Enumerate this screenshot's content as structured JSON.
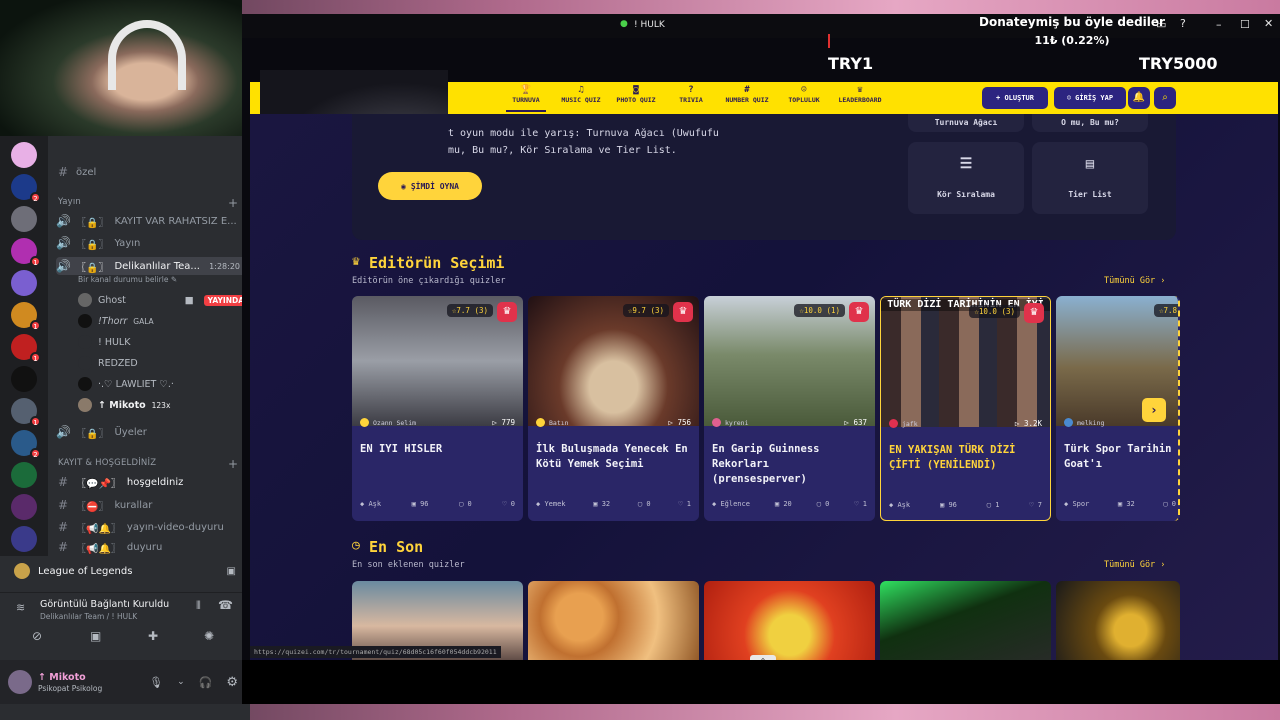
{
  "discord": {
    "channels": [
      {
        "label": "özel",
        "icon": "#"
      },
      {
        "label": "KAYIT VAR RAHATSIZ E...",
        "icon": "🔊"
      },
      {
        "label": "Yayın",
        "icon": "🔊"
      },
      {
        "label": "Delikanlılar Tea...",
        "icon": "🔊",
        "time": "1:28:20",
        "status": "Bir kanal durumu belirle ✎"
      }
    ],
    "category_yayin": "Yayın",
    "members": [
      {
        "name": "Ghost",
        "badge": "YAYINDA"
      },
      {
        "name": "!Thorr",
        "tag": "GALA"
      },
      {
        "name": "! HULK"
      },
      {
        "name": "REDZED"
      },
      {
        "name": "·.♡ LAWLIET ♡.·"
      },
      {
        "name": "↑ Mikoto",
        "tag": "123x"
      }
    ],
    "uyeler": "Üyeler",
    "category_kayit": "KAYIT & HOŞGELDİNİZ",
    "text_channels": [
      {
        "label": "hoşgeldiniz"
      },
      {
        "label": "kurallar"
      },
      {
        "label": "yayın-video-duyuru"
      },
      {
        "label": "duyuru"
      }
    ],
    "game": "League of Legends",
    "voice_status": "Görüntülü Bağlantı Kuruldu",
    "voice_channel": "Delikanlılar Team / ! HULK",
    "user_name": "↑ Mikoto",
    "user_status": "Psikopat Psikolog"
  },
  "window": {
    "tab_title": "! HULK",
    "donation_title": "Donateymiş bu öyle dediler",
    "donation_amount": "11₺ (0.22%)",
    "goal_start": "TRY1",
    "goal_end": "TRY5000"
  },
  "nav": {
    "items": [
      {
        "label": "TURNUVA",
        "icon": "🏆"
      },
      {
        "label": "MUSIC QUIZ",
        "icon": "♫"
      },
      {
        "label": "PHOTO QUIZ",
        "icon": "◙"
      },
      {
        "label": "TRIVIA",
        "icon": "?"
      },
      {
        "label": "NUMBER QUIZ",
        "icon": "#"
      },
      {
        "label": "TOPLULUK",
        "icon": "☺"
      },
      {
        "label": "LEADERBOARD",
        "icon": "♛"
      }
    ],
    "create": "+ OLUŞTUR",
    "login": "GİRİŞ YAP"
  },
  "hero": {
    "text_line1": "t oyun modu ile yarış: Turnuva Ağacı (Uwufufu",
    "text_line2": "mu, Bu mu?, Kör Sıralama ve Tier List.",
    "play_button": "ŞİMDİ OYNA",
    "modes": [
      "Turnuva Ağacı",
      "O mu, Bu mu?",
      "Kör Sıralama",
      "Tier List"
    ]
  },
  "editors": {
    "title": "Editörün Seçimi",
    "subtitle": "Editörün öne çıkardığı quizler",
    "see_all": "Tümünü Gör ›",
    "cards": [
      {
        "title": "EN IYI HISLER",
        "author": "Ozann Selim",
        "plays": "779",
        "rating": "7.7 (3)",
        "category": "Aşk",
        "count": "96",
        "comments": "0",
        "likes": "0"
      },
      {
        "title": "İlk Buluşmada Yenecek En Kötü Yemek Seçimi",
        "author": "Batın",
        "plays": "756",
        "rating": "9.7 (3)",
        "category": "Yemek",
        "count": "32",
        "comments": "0",
        "likes": "1"
      },
      {
        "title": "En Garip Guinness Rekorları (prensesperver)",
        "author": "kyreni",
        "plays": "637",
        "rating": "10.0 (1)",
        "category": "Eğlence",
        "count": "20",
        "comments": "0",
        "likes": "1"
      },
      {
        "title": "EN YAKIŞAN TÜRK DİZİ ÇİFTİ (YENİLENDİ)",
        "author": "jafk",
        "plays": "3.2K",
        "rating": "10.0 (3)",
        "category": "Aşk",
        "count": "96",
        "comments": "1",
        "likes": "7",
        "overlay": "TÜRK DİZİ TARİHİNİN EN İYİ"
      },
      {
        "title": "Türk Spor Tarihin Goat'ı",
        "author": "melking",
        "plays": "",
        "rating": "7.8",
        "category": "Spor",
        "count": "32",
        "comments": "0",
        "likes": ""
      }
    ]
  },
  "recent": {
    "title": "En Son",
    "subtitle": "En son eklenen quizler",
    "see_all": "Tümünü Gör ›"
  },
  "status_url": "https://quizei.com/tr/tournament/quiz/68d05c16f60f054ddcb92011"
}
